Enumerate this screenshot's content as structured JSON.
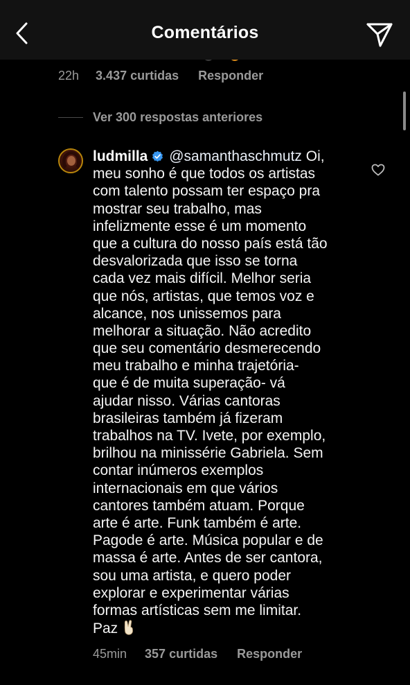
{
  "header": {
    "title": "Comentários",
    "back_icon": "chevron-left-icon",
    "send_icon": "paper-plane-icon"
  },
  "parent_meta": {
    "time": "22h",
    "likes": "3.437 curtidas",
    "reply": "Responder"
  },
  "view_more": {
    "label": "Ver 300 respostas anteriores"
  },
  "comment": {
    "username": "ludmilla",
    "verified_icon": "verified-badge-icon",
    "mention": "@samanthaschmutz",
    "lines": [
      " Oi,",
      "meu sonho é que todos os artistas",
      "com talento possam ter espaço pra",
      "mostrar seu trabalho, mas",
      "infelizmente esse é um momento",
      "que a cultura do nosso país está tão",
      "desvalorizada que isso se torna",
      "cada vez mais difícil. Melhor seria",
      "que nós, artistas, que temos voz e",
      "alcance, nos unissemos para",
      "melhorar a situação. Não acredito",
      "que seu comentário desmerecendo",
      "meu trabalho e minha trajetória-",
      "que é de muita superação- vá",
      "ajudar nisso. Várias cantoras",
      "brasileiras também já fizeram",
      "trabalhos na TV. Ivete, por exemplo,",
      "brilhou na minissérie Gabriela. Sem",
      "contar inúmeros exemplos",
      "internacionais em que vários",
      "cantores também atuam. Porque",
      "arte é arte. Funk também é arte.",
      "Pagode é arte. Música popular e de",
      "massa é arte. Antes de ser cantora,",
      "sou uma artista, e quero poder",
      "explorar e experimentar várias",
      "formas artísticas sem me limitar.",
      "Paz"
    ],
    "emoji": "victory-hand-emoji",
    "like_icon": "heart-outline-icon",
    "meta": {
      "time": "45min",
      "likes": "357 curtidas",
      "reply": "Responder"
    }
  },
  "colors": {
    "background": "#000000",
    "header_background": "#121212",
    "primary_text": "#f5f5f5",
    "secondary_text": "#9a9a9a",
    "verified_blue": "#3897f0"
  }
}
